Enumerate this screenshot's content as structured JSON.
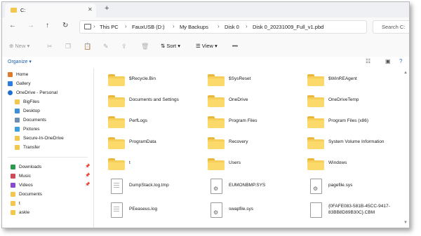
{
  "tab": {
    "title": "C:",
    "close": "✕",
    "new_tab": "+"
  },
  "nav": {
    "back": "←",
    "forward": "→",
    "up": "↑",
    "refresh": "↻"
  },
  "breadcrumb": {
    "items": [
      "This PC",
      "FauxUSB (D:)",
      "My Backups",
      "Disk 0",
      "Disk 0_20231009_Full_v1.pbd"
    ],
    "sep": "›"
  },
  "search": {
    "placeholder": "Search C:"
  },
  "toolbar": {
    "new": "⊕ New ▾",
    "sort": "⇅ Sort ▾",
    "view": "☰ View ▾",
    "more": "•••"
  },
  "organize": {
    "label": "Organize ▾"
  },
  "sidebar": {
    "items": [
      {
        "label": "Home",
        "icon": "home-icon",
        "color": "#e07a2b"
      },
      {
        "label": "Gallery",
        "icon": "gallery-icon",
        "color": "#2b7de0"
      },
      {
        "label": "OneDrive - Personal",
        "icon": "cloud-icon",
        "color": "#1f6fd0"
      },
      {
        "label": "BigFiles",
        "icon": "folder-icon",
        "color": "#f3c64e"
      },
      {
        "label": "Desktop",
        "icon": "desktop-icon",
        "color": "#3d8fd8"
      },
      {
        "label": "Documents",
        "icon": "documents-icon",
        "color": "#6d8fb3"
      },
      {
        "label": "Pictures",
        "icon": "pictures-icon",
        "color": "#3aa0e0"
      },
      {
        "label": "Secure-In-OneDrive",
        "icon": "folder-icon",
        "color": "#f3c64e"
      },
      {
        "label": "Transfer",
        "icon": "folder-icon",
        "color": "#f3c64e"
      },
      {
        "label": "Downloads",
        "icon": "download-icon",
        "color": "#2b9a4a"
      },
      {
        "label": "Music",
        "icon": "music-icon",
        "color": "#d04a5a"
      },
      {
        "label": "Videos",
        "icon": "video-icon",
        "color": "#8a4ad0"
      },
      {
        "label": "Documents",
        "icon": "folder-icon",
        "color": "#f3c64e"
      },
      {
        "label": "t",
        "icon": "folder-icon",
        "color": "#f3c64e"
      },
      {
        "label": "askle",
        "icon": "folder-icon",
        "color": "#f3c64e"
      }
    ],
    "pin": "📌"
  },
  "files": [
    {
      "name": "$Recycle.Bin",
      "kind": "folder"
    },
    {
      "name": "$SysReset",
      "kind": "folder"
    },
    {
      "name": "$WinREAgent",
      "kind": "folder"
    },
    {
      "name": "Documents and Settings",
      "kind": "folder"
    },
    {
      "name": "OneDrive",
      "kind": "folder"
    },
    {
      "name": "OneDriveTemp",
      "kind": "folder"
    },
    {
      "name": "PerfLogs",
      "kind": "folder"
    },
    {
      "name": "Program Files",
      "kind": "folder"
    },
    {
      "name": "Program Files (x86)",
      "kind": "folder"
    },
    {
      "name": "ProgramData",
      "kind": "folder"
    },
    {
      "name": "Recovery",
      "kind": "folder"
    },
    {
      "name": "System Volume Information",
      "kind": "folder"
    },
    {
      "name": "t",
      "kind": "folder"
    },
    {
      "name": "Users",
      "kind": "folder"
    },
    {
      "name": "Windows",
      "kind": "folder"
    },
    {
      "name": "DumpStack.log.tmp",
      "kind": "file"
    },
    {
      "name": "EUMONBMP.SYS",
      "kind": "sysfile"
    },
    {
      "name": "pagefile.sys",
      "kind": "sysfile"
    },
    {
      "name": "PEeaseus.log",
      "kind": "file"
    },
    {
      "name": "swapfile.sys",
      "kind": "sysfile"
    },
    {
      "name": "{0FAFE083-581B-45CC-9417-83BB8D89B30C}.CBM",
      "kind": "file"
    }
  ],
  "scroll": {
    "up": "▲",
    "down": "▼"
  }
}
